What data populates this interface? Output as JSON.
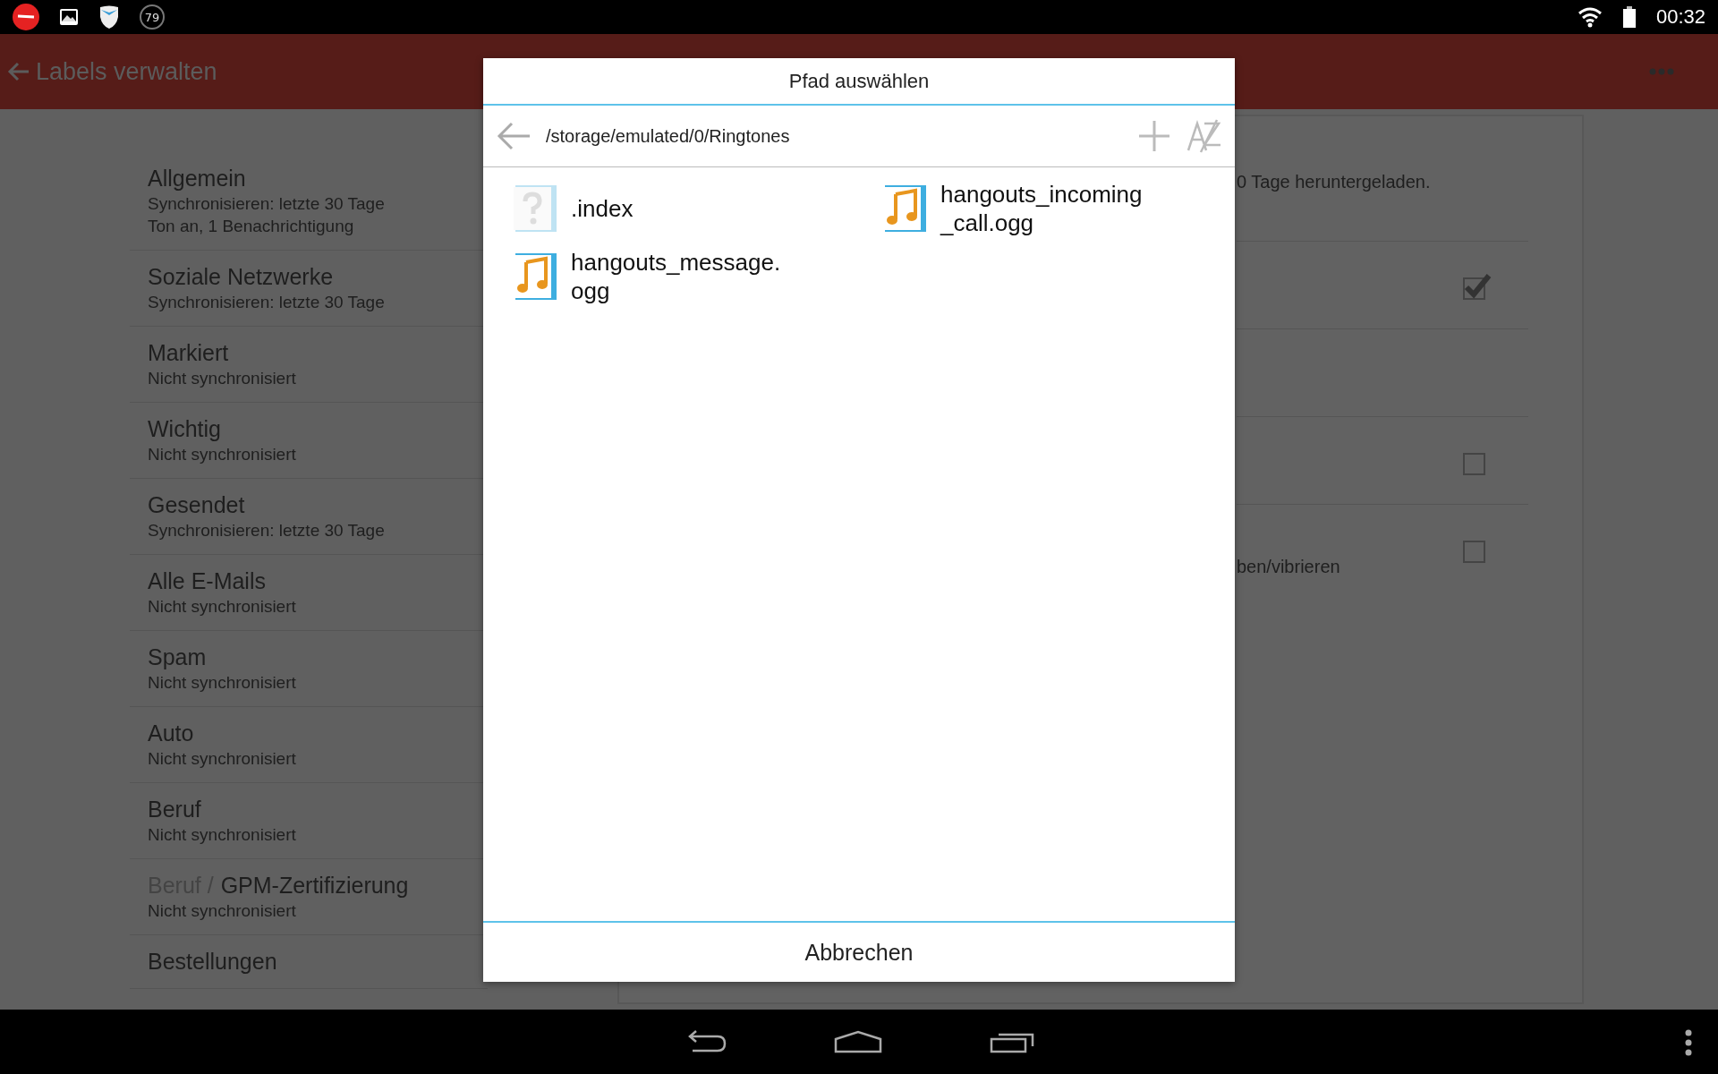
{
  "status_bar": {
    "notification_count": "79",
    "time": "00:32"
  },
  "app_bar": {
    "title": "Labels verwalten"
  },
  "labels": [
    {
      "title": "Allgemein",
      "subtitles": [
        "Synchronisieren: letzte 30 Tage",
        "Ton an, 1 Benachrichtigung"
      ]
    },
    {
      "title": "Soziale Netzwerke",
      "subtitles": [
        "Synchronisieren: letzte 30 Tage"
      ]
    },
    {
      "title": "Markiert",
      "subtitles": [
        "Nicht synchronisiert"
      ]
    },
    {
      "title": "Wichtig",
      "subtitles": [
        "Nicht synchronisiert"
      ]
    },
    {
      "title": "Gesendet",
      "subtitles": [
        "Synchronisieren: letzte 30 Tage"
      ]
    },
    {
      "title": "Alle E-Mails",
      "subtitles": [
        "Nicht synchronisiert"
      ]
    },
    {
      "title": "Spam",
      "subtitles": [
        "Nicht synchronisiert"
      ]
    },
    {
      "title": "Auto",
      "subtitles": [
        "Nicht synchronisiert"
      ]
    },
    {
      "title": "Beruf",
      "subtitles": [
        "Nicht synchronisiert"
      ]
    },
    {
      "parent": "Beruf /",
      "title": "GPM-Zertifizierung",
      "subtitles": [
        "Nicht synchronisiert"
      ]
    },
    {
      "title": "Bestellungen"
    }
  ],
  "settings": {
    "description": "0 Tage heruntergeladen.",
    "rows": [
      {
        "kind": "checkbox",
        "checked": true
      },
      {
        "kind": "plain"
      },
      {
        "kind": "checkbox",
        "checked": false
      },
      {
        "kind": "checkbox",
        "checked": false,
        "text": "ben/vibrieren"
      }
    ]
  },
  "dialog": {
    "title": "Pfad auswählen",
    "path": "/storage/emulated/0/Ringtones",
    "files": [
      {
        "name": ".index",
        "kind": "unknown"
      },
      {
        "name": "hangouts_incoming_call.ogg",
        "kind": "audio"
      },
      {
        "name": "hangouts_message.ogg",
        "kind": "audio"
      }
    ],
    "cancel": "Abbrechen"
  }
}
